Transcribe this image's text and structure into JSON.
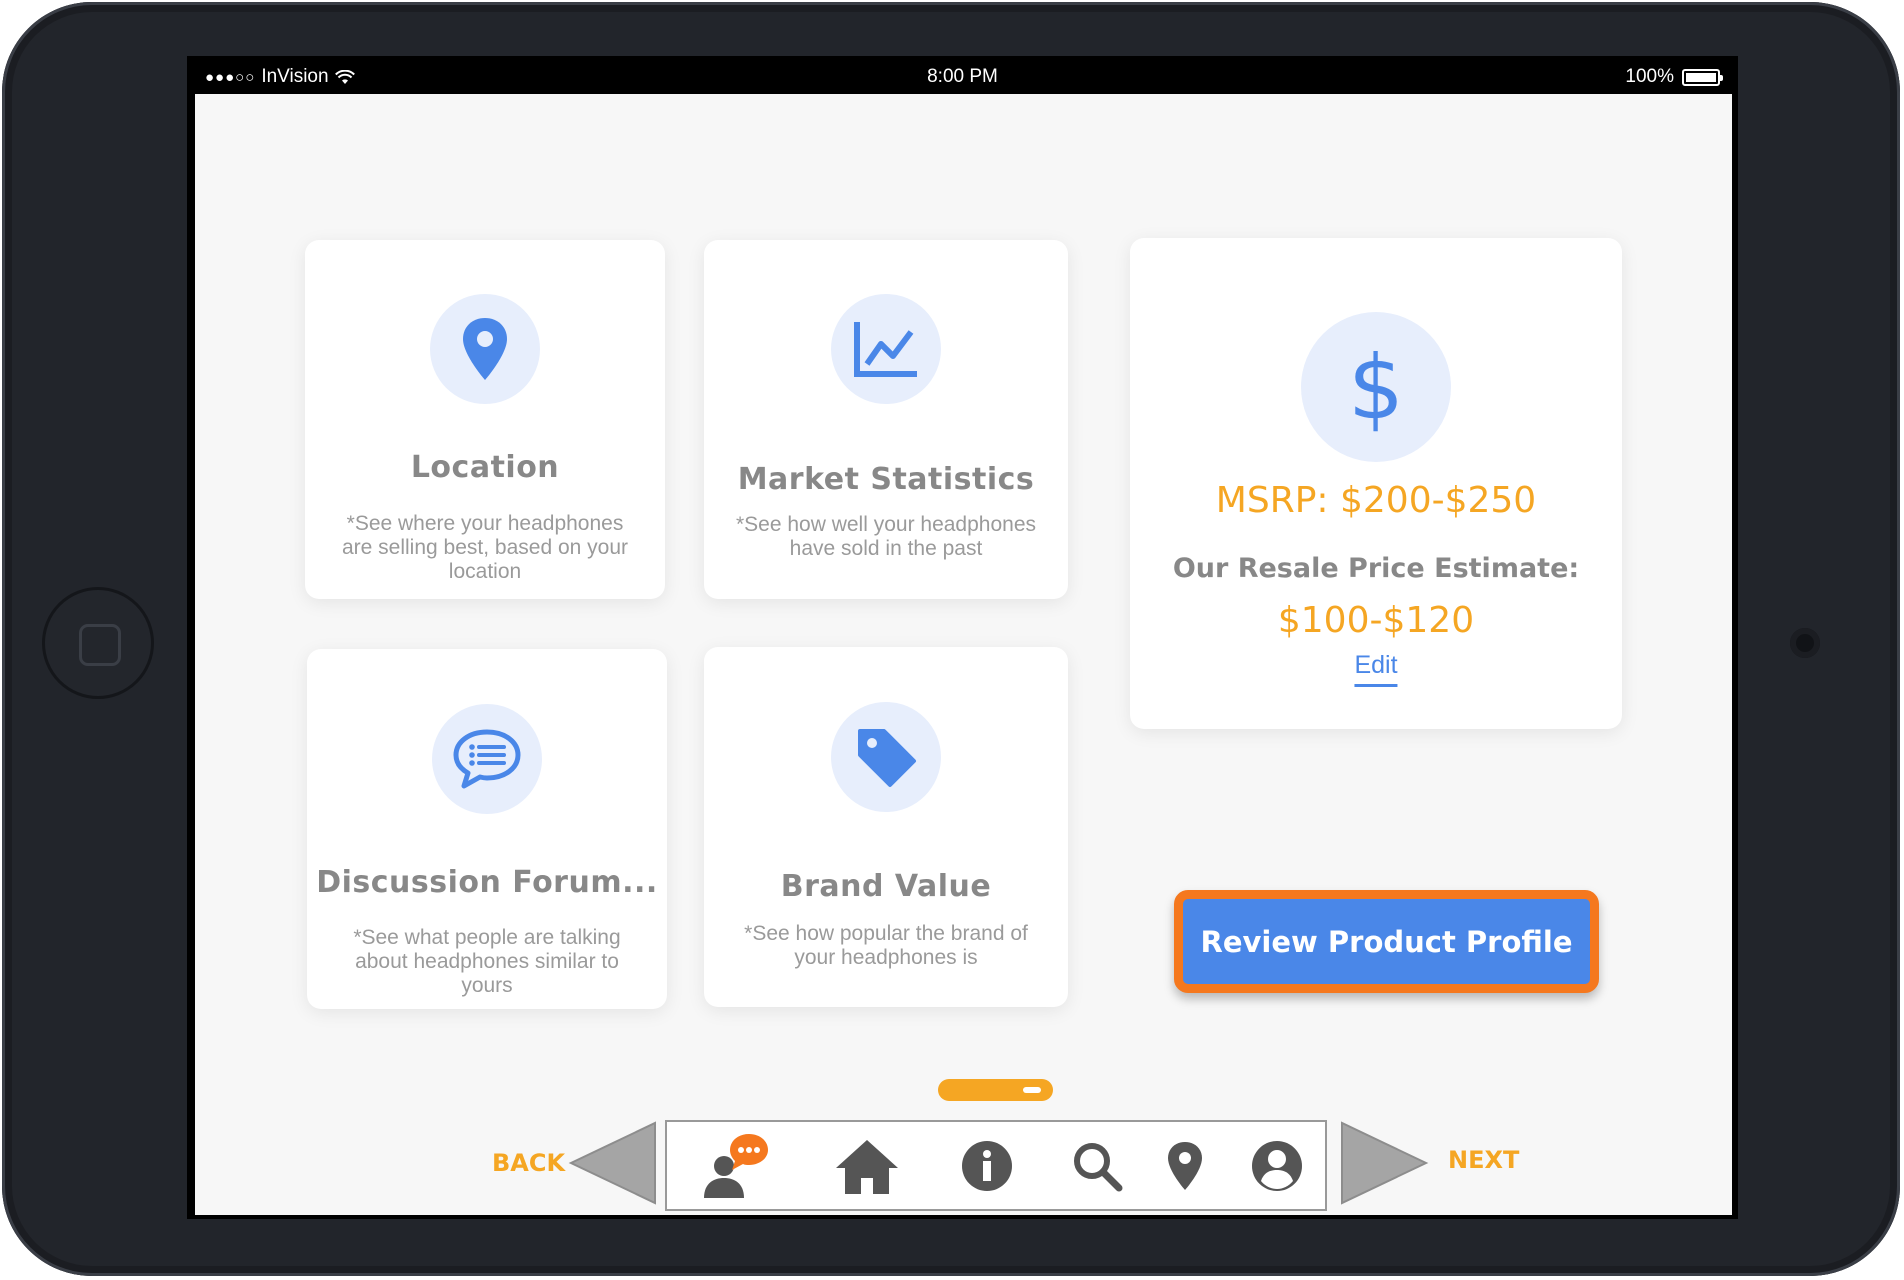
{
  "status_bar": {
    "signal": "●●●○○",
    "carrier": "InVision",
    "time": "8:00 PM",
    "battery": "100%"
  },
  "cards": {
    "location": {
      "title": "Location",
      "description": "*See where your headphones are selling best, based on your location",
      "icon": "location-pin-icon"
    },
    "market": {
      "title": "Market Statistics",
      "description": "*See how well your headphones have sold in the past",
      "icon": "line-chart-icon"
    },
    "forum": {
      "title": "Discussion Forum...",
      "description": "*See what people are talking about headphones similar to yours",
      "icon": "speech-bubble-icon"
    },
    "brand": {
      "title": "Brand Value",
      "description": "*See how popular the brand of your headphones is",
      "icon": "price-tag-icon"
    }
  },
  "price": {
    "icon": "dollar-icon",
    "msrp": "MSRP: $200-$250",
    "estimate_label": "Our Resale Price Estimate:",
    "estimate_value": "$100-$120",
    "edit_label": "Edit"
  },
  "review_button": "Review Product Profile",
  "nav": {
    "back": "BACK",
    "next": "NEXT",
    "icons": [
      "profile-chat-icon",
      "home-icon",
      "info-icon",
      "search-icon",
      "location-icon",
      "account-icon"
    ]
  },
  "colors": {
    "accent_orange": "#f5a623",
    "accent_blue": "#4a87e8",
    "button_border": "#f5781e",
    "icon_bg": "#e7eefc"
  }
}
